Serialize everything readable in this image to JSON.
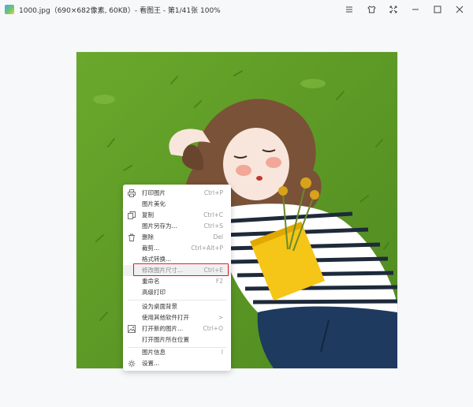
{
  "window": {
    "title": "1000.jpg（690×682像素, 60KB）- 看图王 - 第1/41张 100%",
    "controls": [
      "menu-icon",
      "skin-icon",
      "fullscreen-icon",
      "minimize-icon",
      "maximize-icon",
      "close-icon"
    ]
  },
  "context_menu": {
    "items": [
      {
        "label": "打印图片",
        "shortcut": "Ctrl+P",
        "icon": "printer-icon"
      },
      {
        "label": "图片美化",
        "shortcut": "",
        "icon": ""
      },
      {
        "label": "复制",
        "shortcut": "Ctrl+C",
        "icon": "copy-icon"
      },
      {
        "label": "图片另存为...",
        "shortcut": "Ctrl+S",
        "icon": ""
      },
      {
        "label": "删除",
        "shortcut": "Del",
        "icon": "trash-icon"
      },
      {
        "label": "裁剪...",
        "shortcut": "Ctrl+Alt+P",
        "icon": ""
      },
      {
        "label": "格式转换...",
        "shortcut": "",
        "icon": ""
      },
      {
        "label": "修改图片尺寸...",
        "shortcut": "Ctrl+E",
        "icon": ""
      },
      {
        "label": "重命名",
        "shortcut": "F2",
        "icon": ""
      },
      {
        "label": "高级打印",
        "shortcut": "",
        "icon": ""
      },
      {
        "label": "设为桌面背景",
        "shortcut": "",
        "icon": ""
      },
      {
        "label": "使用其他软件打开",
        "shortcut": ">",
        "icon": ""
      },
      {
        "label": "打开新的图片...",
        "shortcut": "Ctrl+O",
        "icon": "open-image-icon"
      },
      {
        "label": "打开图片所在位置",
        "shortcut": "",
        "icon": ""
      },
      {
        "label": "图片信息",
        "shortcut": "I",
        "icon": ""
      },
      {
        "label": "设置...",
        "shortcut": "",
        "icon": "gear-icon"
      }
    ],
    "highlighted": "修改图片尺寸...",
    "highlight_color": "#d41b1b"
  }
}
